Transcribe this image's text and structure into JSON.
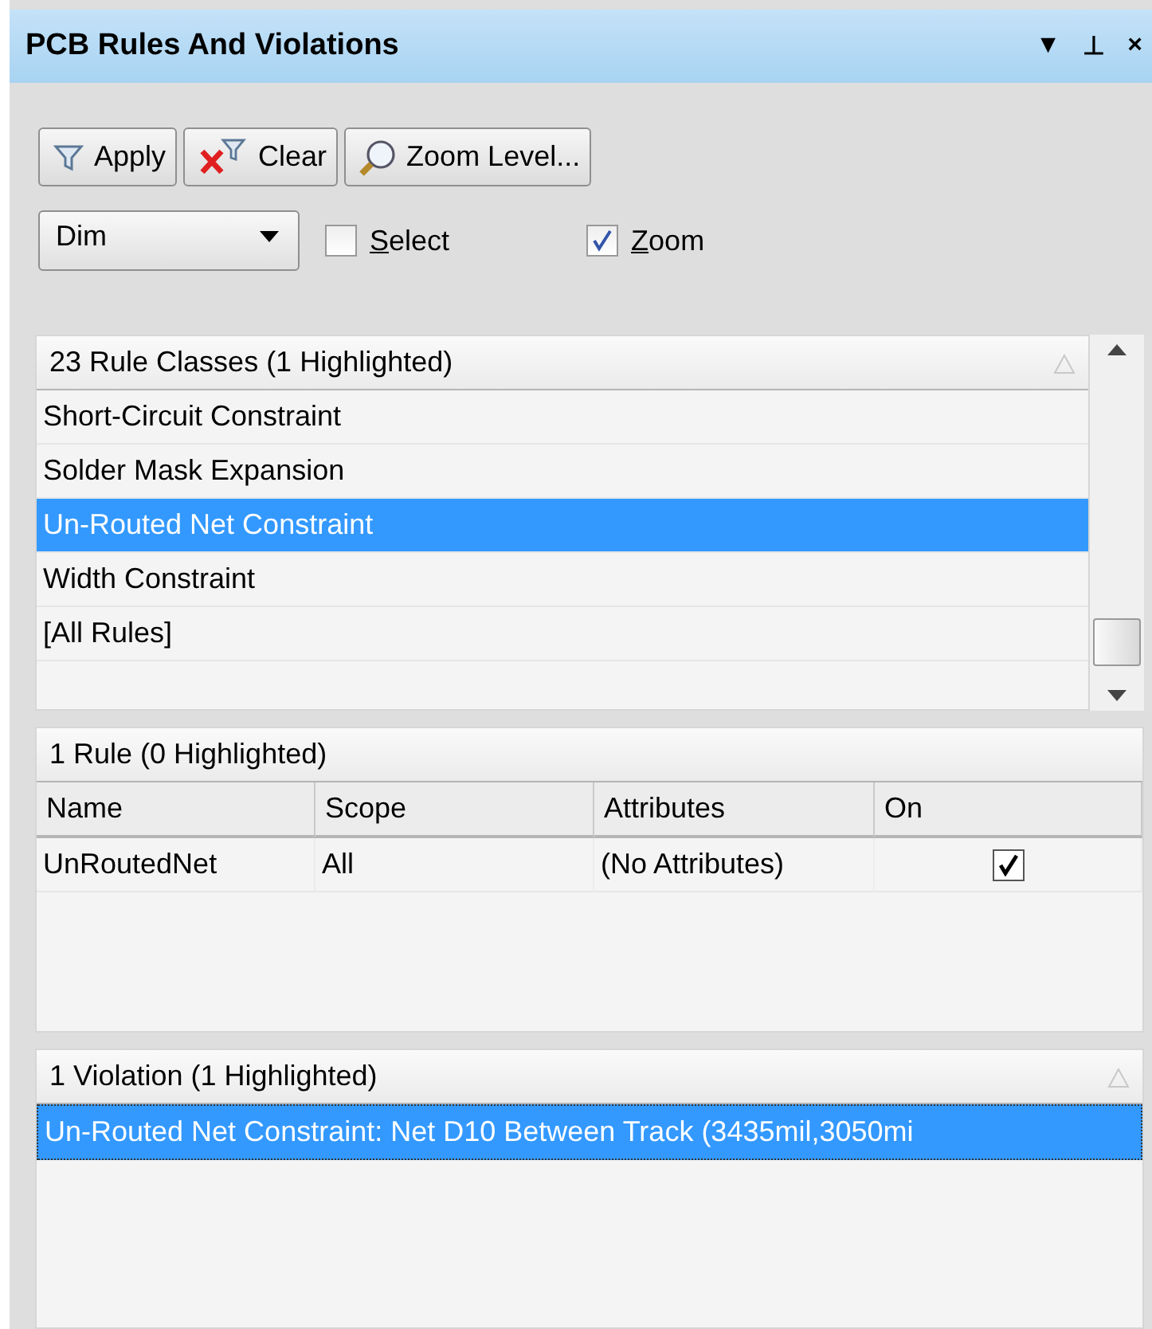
{
  "panel": {
    "title": "PCB Rules And Violations",
    "title_buttons": [
      "▼",
      "⊥",
      "×"
    ]
  },
  "toolbar": {
    "buttons": [
      {
        "kind": "apply",
        "label": "Apply"
      },
      {
        "kind": "clear",
        "label": "Clear"
      },
      {
        "kind": "zoom",
        "label": "Zoom Level..."
      }
    ]
  },
  "options": {
    "mode": {
      "value": "Dim"
    },
    "checkboxes": [
      {
        "label": "Select",
        "checked": false
      },
      {
        "label": "Zoom",
        "checked": true
      }
    ]
  },
  "rule_classes": {
    "header": "23 Rule Classes (1 Highlighted)",
    "rows": [
      {
        "label": "Short-Circuit Constraint",
        "selected": false
      },
      {
        "label": "Solder Mask Expansion",
        "selected": false
      },
      {
        "label": "Un-Routed Net Constraint",
        "selected": true
      },
      {
        "label": "Width Constraint",
        "selected": false
      },
      {
        "label": "[All Rules]",
        "selected": false
      }
    ]
  },
  "rules": {
    "header": "1 Rule (0 Highlighted)",
    "columns": [
      "Name",
      "Scope",
      "Attributes",
      "On"
    ],
    "rows": [
      {
        "name": "UnRoutedNet",
        "scope": "All",
        "attributes": "(No Attributes)",
        "on": true
      }
    ]
  },
  "violations": {
    "header": "1 Violation (1 Highlighted)",
    "rows": [
      {
        "label": "Un-Routed Net Constraint: Net D10 Between Track (3435mil,3050mi",
        "selected": true
      }
    ]
  }
}
